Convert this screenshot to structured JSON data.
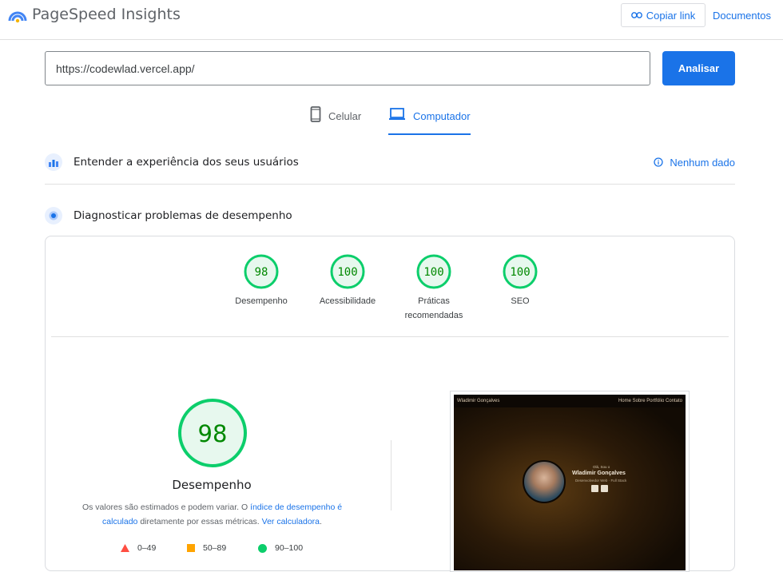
{
  "header": {
    "title": "PageSpeed Insights",
    "copy_link": "Copiar link",
    "docs": "Documentos"
  },
  "url_bar": {
    "value": "https://codewlad.vercel.app/",
    "analyze": "Analisar"
  },
  "tabs": {
    "mobile": "Celular",
    "desktop": "Computador",
    "active": "desktop"
  },
  "sections": {
    "field_data": {
      "title": "Entender a experiência dos seus usuários",
      "status": "Nenhum dado"
    },
    "lab_data": {
      "title": "Diagnosticar problemas de desempenho"
    }
  },
  "scores": [
    {
      "value": "98",
      "label": "Desempenho"
    },
    {
      "value": "100",
      "label": "Acessibilidade"
    },
    {
      "value": "100",
      "label": "Práticas recomendadas"
    },
    {
      "value": "100",
      "label": "SEO"
    }
  ],
  "performance": {
    "score": "98",
    "label": "Desempenho",
    "note_1": "Os valores são estimados e podem variar. O ",
    "note_link_1": "índice de desempenho é calculado",
    "note_2": " diretamente por essas métricas. ",
    "note_link_2": "Ver calculadora",
    "note_3": "."
  },
  "legend": [
    {
      "range": "0–49",
      "color": "#ff4e42",
      "shape": "triangle"
    },
    {
      "range": "50–89",
      "color": "#ffa400",
      "shape": "square"
    },
    {
      "range": "90–100",
      "color": "#0cce6b",
      "shape": "circle"
    }
  ],
  "thumbnail": {
    "site_name": "Wladimir Gonçalves",
    "nav": "Home  Sobre  Portfólio  Contato",
    "greeting": "Olá, Sou o",
    "name": "Wladimir Gonçalves",
    "role": "Desenvolvedor Web · Full Stack"
  },
  "colors": {
    "accent": "#1a73e8",
    "pass": "#0cce6b",
    "pass_text": "#008800"
  }
}
